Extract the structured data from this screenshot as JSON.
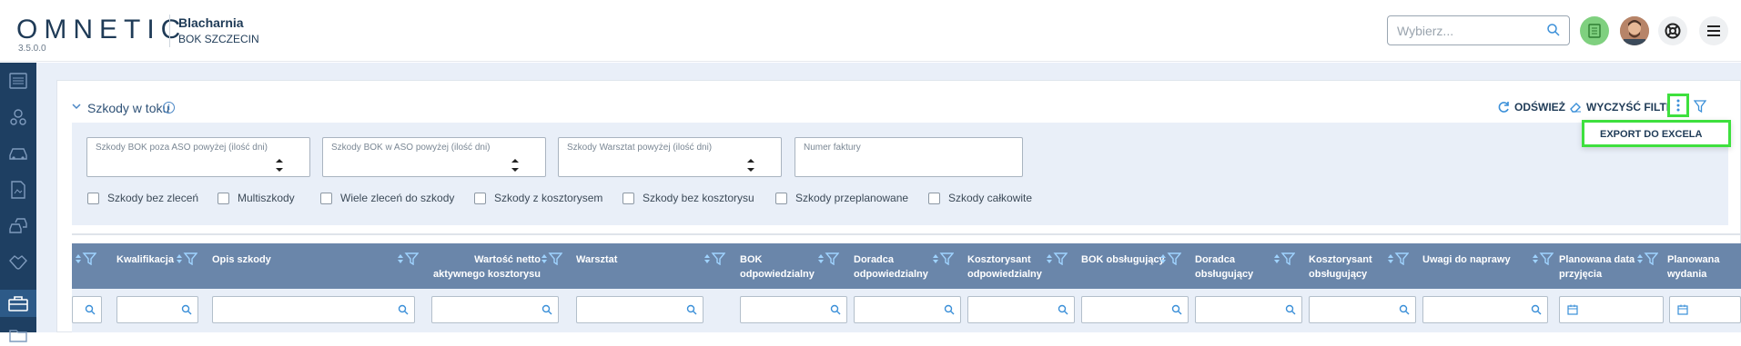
{
  "header": {
    "logo": "OMNETIC",
    "version": "3.5.0.0",
    "org_name": "Blacharnia",
    "org_sub": "BOK SZCZECIN",
    "search_placeholder": "Wybierz..."
  },
  "sidebar": {
    "items": [
      "list-icon",
      "users-icon",
      "car-icon",
      "document-icon",
      "cars-icon",
      "handshake-icon",
      "briefcase-icon"
    ],
    "active": "briefcase-icon"
  },
  "section": {
    "title": "Szkody w toku",
    "refresh_label": "ODŚWIEŻ",
    "clear_label": "WYCZYŚĆ FILTRY",
    "menu_item": "EXPORT DO EXCELA"
  },
  "filters": {
    "fields": [
      {
        "label": "Szkody BOK poza ASO powyżej (ilość dni)",
        "value": ""
      },
      {
        "label": "Szkody BOK w ASO powyżej (ilość dni)",
        "value": ""
      },
      {
        "label": "Szkody Warsztat powyżej (ilość dni)",
        "value": ""
      },
      {
        "label": "Numer faktury",
        "value": ""
      }
    ],
    "checkboxes": [
      "Szkody bez zleceń",
      "Multiszkody",
      "Wiele zleceń do szkody",
      "Szkody z kosztorysem",
      "Szkody bez kosztorysu",
      "Szkody przeplanowane",
      "Szkody całkowite"
    ]
  },
  "table": {
    "columns": [
      {
        "line1": "Kwalifikacja",
        "line2": ""
      },
      {
        "line1": "Opis szkody",
        "line2": ""
      },
      {
        "line1": "Wartość netto",
        "line2": "aktywnego kosztorysu"
      },
      {
        "line1": "Warsztat",
        "line2": ""
      },
      {
        "line1": "BOK",
        "line2": "odpowiedzialny"
      },
      {
        "line1": "Doradca",
        "line2": "odpowiedzialny"
      },
      {
        "line1": "Kosztorysant",
        "line2": "odpowiedzialny"
      },
      {
        "line1": "BOK obsługujący",
        "line2": ""
      },
      {
        "line1": "Doradca",
        "line2": "obsługujący"
      },
      {
        "line1": "Kosztorysant",
        "line2": "obsługujący"
      },
      {
        "line1": "Uwagi do naprawy",
        "line2": ""
      },
      {
        "line1": "Planowana data",
        "line2": "przyjęcia"
      },
      {
        "line1": "Planowana",
        "line2": "wydania"
      }
    ]
  },
  "colors": {
    "sidebar": "#1e3f62",
    "table_header": "#6a86aa",
    "highlight": "#3ee03e",
    "panel_bg": "#e9eff8"
  }
}
